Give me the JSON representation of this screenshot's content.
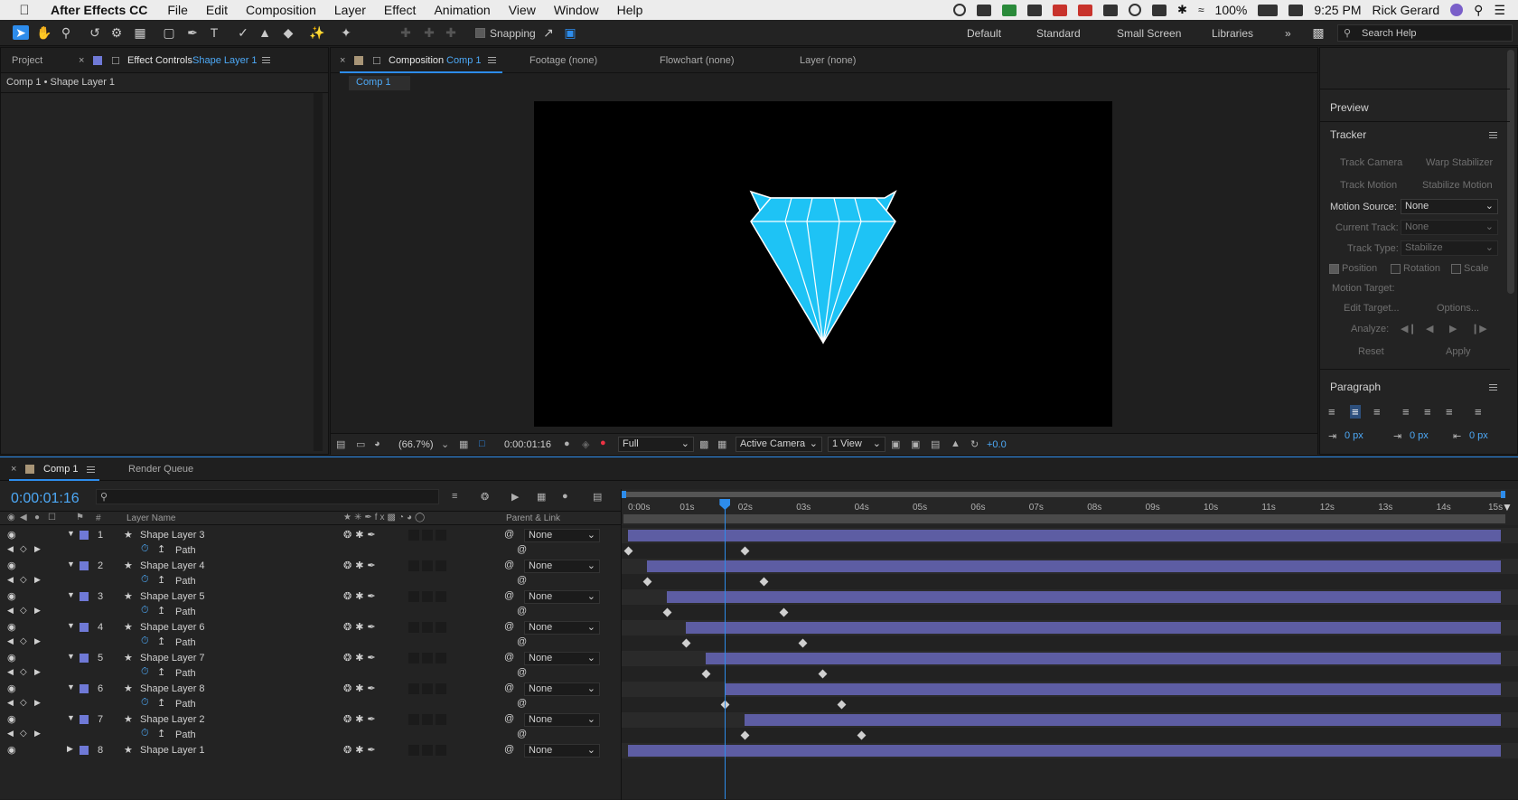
{
  "menubar": {
    "app": "After Effects CC",
    "items": [
      "File",
      "Edit",
      "Composition",
      "Layer",
      "Effect",
      "Animation",
      "View",
      "Window",
      "Help"
    ],
    "battery": "100%",
    "time": "9:25 PM",
    "user": "Rick Gerard"
  },
  "toolbar": {
    "snapping": "Snapping",
    "workspaces": [
      "Default",
      "Standard",
      "Small Screen",
      "Libraries"
    ],
    "search_placeholder": "Search Help"
  },
  "left_panel": {
    "tab_project": "Project",
    "tab_effect_controls": "Effect Controls",
    "tab_effect_target": "Shape Layer 1",
    "subtitle": "Comp 1 • Shape Layer 1"
  },
  "viewer": {
    "tab_composition": "Composition",
    "tab_comp_name": "Comp 1",
    "tab_footage": "Footage (none)",
    "tab_flowchart": "Flowchart (none)",
    "tab_layer": "Layer (none)",
    "sub_tab": "Comp 1",
    "zoom": "(66.7%)",
    "timecode": "0:00:01:16",
    "resolution": "Full",
    "camera": "Active Camera",
    "views": "1 View",
    "exposure": "+0.0"
  },
  "right_panel": {
    "preview": "Preview",
    "tracker": "Tracker",
    "track_camera": "Track Camera",
    "warp_stabilizer": "Warp Stabilizer",
    "track_motion": "Track Motion",
    "stabilize_motion": "Stabilize Motion",
    "motion_source_label": "Motion Source:",
    "motion_source_value": "None",
    "current_track_label": "Current Track:",
    "current_track_value": "None",
    "track_type_label": "Track Type:",
    "track_type_value": "Stabilize",
    "position": "Position",
    "rotation": "Rotation",
    "scale": "Scale",
    "motion_target_label": "Motion Target:",
    "edit_target": "Edit Target...",
    "options": "Options...",
    "analyze_label": "Analyze:",
    "reset": "Reset",
    "apply": "Apply",
    "paragraph": "Paragraph",
    "indent_values": [
      "0 px",
      "0 px",
      "0 px"
    ]
  },
  "timeline": {
    "tab_comp": "Comp 1",
    "tab_render_queue": "Render Queue",
    "current_time": "0:00:01:16",
    "col_layer_name": "Layer Name",
    "col_parent": "Parent & Link",
    "col_number": "#",
    "ruler_labels": [
      "0:00s",
      "01s",
      "02s",
      "03s",
      "04s",
      "05s",
      "06s",
      "07s",
      "08s",
      "09s",
      "10s",
      "11s",
      "12s",
      "13s",
      "14s",
      "15s"
    ],
    "playhead_seconds": 1.667,
    "duration_seconds": 15,
    "property_name": "Path",
    "parent_value": "None",
    "layers": [
      {
        "num": "1",
        "name": "Shape Layer 3",
        "in": 0.0,
        "kf": [
          0.0,
          2.0
        ],
        "expanded": true
      },
      {
        "num": "2",
        "name": "Shape Layer 4",
        "in": 0.333,
        "kf": [
          0.333,
          2.333
        ],
        "expanded": true
      },
      {
        "num": "3",
        "name": "Shape Layer 5",
        "in": 0.667,
        "kf": [
          0.667,
          2.667
        ],
        "expanded": true
      },
      {
        "num": "4",
        "name": "Shape Layer 6",
        "in": 1.0,
        "kf": [
          1.0,
          3.0
        ],
        "expanded": true
      },
      {
        "num": "5",
        "name": "Shape Layer 7",
        "in": 1.333,
        "kf": [
          1.333,
          3.333
        ],
        "expanded": true
      },
      {
        "num": "6",
        "name": "Shape Layer 8",
        "in": 1.667,
        "kf": [
          1.667,
          3.667
        ],
        "expanded": true
      },
      {
        "num": "7",
        "name": "Shape Layer 2",
        "in": 2.0,
        "kf": [
          2.0,
          4.0
        ],
        "expanded": true
      },
      {
        "num": "8",
        "name": "Shape Layer 1",
        "in": 0.0,
        "kf": [],
        "expanded": false
      }
    ]
  },
  "colors": {
    "accent": "#2d8ceb",
    "label": "#6f79d6",
    "bar": "#5d5da3",
    "gem": "#1ec3f5"
  }
}
